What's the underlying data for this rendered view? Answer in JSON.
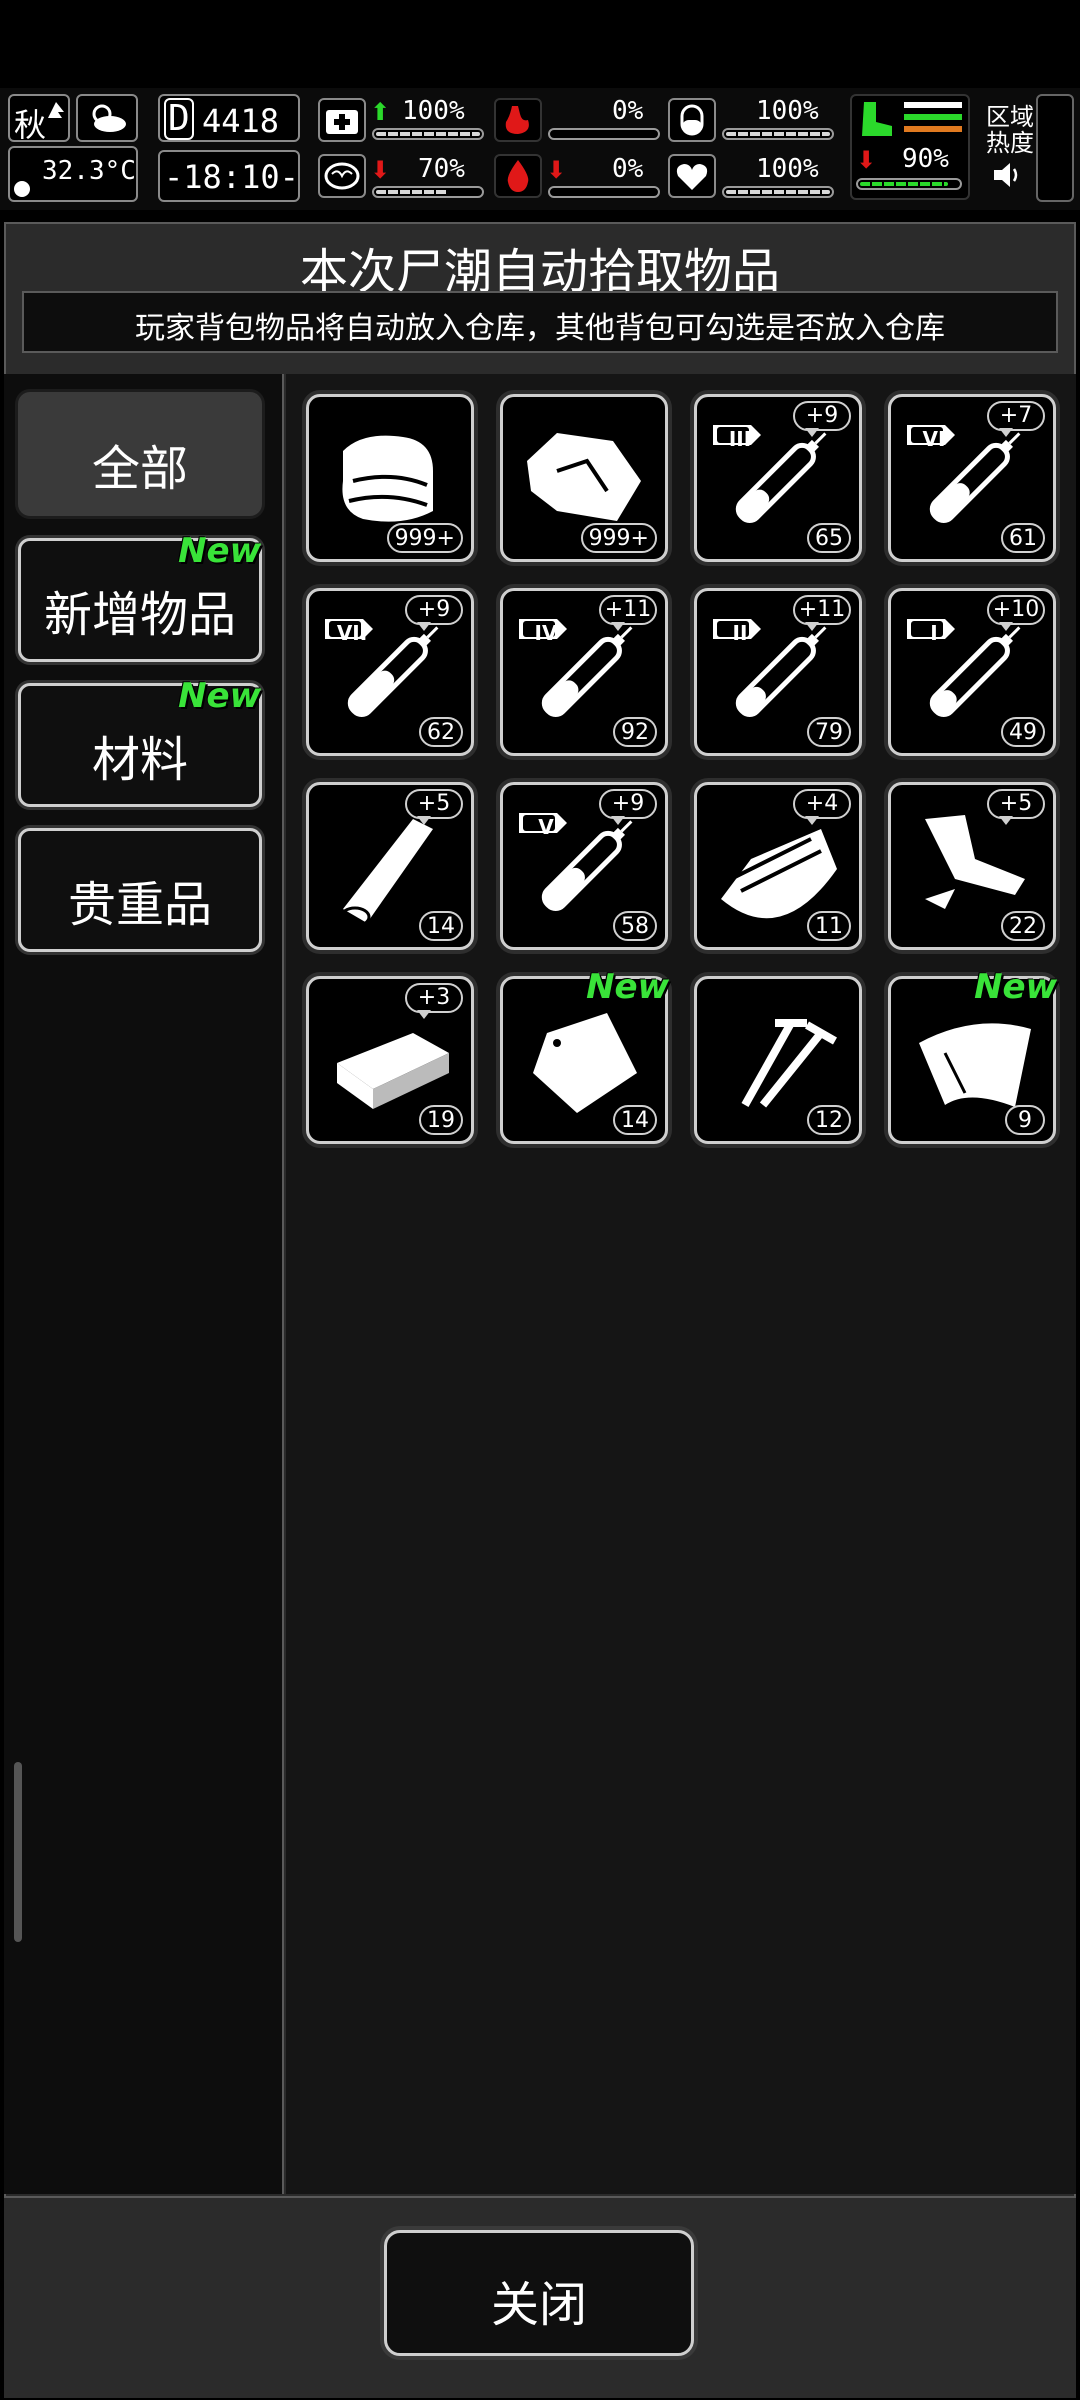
{
  "hud": {
    "season": "秋",
    "temperature": "32.3°C",
    "day": "4418",
    "day_prefix": "D",
    "time": "-18:10-",
    "stats": {
      "health": {
        "value": "100%",
        "fill": 1.0
      },
      "sanity": {
        "value": "70%",
        "fill": 0.7
      },
      "hunger": {
        "value": "0%",
        "fill": 0.0
      },
      "bleeding": {
        "value": "0%",
        "fill": 0.0
      },
      "thirst": {
        "value": "100%",
        "fill": 1.0
      },
      "heart": {
        "value": "100%",
        "fill": 1.0
      },
      "stamina": {
        "value": "90%",
        "fill": 0.9
      }
    },
    "zone_heat_label_line1": "区域",
    "zone_heat_label_line2": "热度"
  },
  "panel": {
    "title": "本次尸潮自动拾取物品",
    "subtitle": "玩家背包物品将自动放入仓库，其他背包可勾选是否放入仓库"
  },
  "categories": [
    {
      "label": "全部",
      "active": true,
      "new": false
    },
    {
      "label": "新增物品",
      "active": false,
      "new": true
    },
    {
      "label": "材料",
      "active": false,
      "new": true
    },
    {
      "label": "贵重品",
      "active": false,
      "new": false
    }
  ],
  "new_tag": "New",
  "items": [
    {
      "icon": "cloth-icon",
      "qty": "999+",
      "plus": ""
    },
    {
      "icon": "ore-icon",
      "qty": "999+",
      "plus": ""
    },
    {
      "icon": "syringe-iii-icon",
      "roman": "III",
      "qty": "65",
      "plus": "+9",
      "level": 0.35
    },
    {
      "icon": "syringe-vi-icon",
      "roman": "VI",
      "qty": "61",
      "plus": "+7",
      "level": 0.45
    },
    {
      "icon": "syringe-vii-icon",
      "roman": "VII",
      "qty": "62",
      "plus": "+9",
      "level": 0.55
    },
    {
      "icon": "syringe-iv-icon",
      "roman": "IV",
      "qty": "92",
      "plus": "+11",
      "level": 0.4
    },
    {
      "icon": "syringe-ii-icon",
      "roman": "II",
      "qty": "79",
      "plus": "+11",
      "level": 0.3
    },
    {
      "icon": "syringe-i-icon",
      "roman": "I",
      "qty": "49",
      "plus": "+10",
      "level": 0.25
    },
    {
      "icon": "wood-plank-icon",
      "qty": "14",
      "plus": "+5"
    },
    {
      "icon": "syringe-v-icon",
      "roman": "V",
      "qty": "58",
      "plus": "+9",
      "level": 0.5
    },
    {
      "icon": "metal-scrap-icon",
      "qty": "11",
      "plus": "+4"
    },
    {
      "icon": "pipe-scrap-icon",
      "qty": "22",
      "plus": "+5"
    },
    {
      "icon": "board-icon",
      "qty": "19",
      "plus": "+3"
    },
    {
      "icon": "bag-icon",
      "qty": "14",
      "plus": "",
      "new": true
    },
    {
      "icon": "nails-icon",
      "qty": "12",
      "plus": ""
    },
    {
      "icon": "sheet-icon",
      "qty": "9",
      "plus": "",
      "new": true
    }
  ],
  "footer": {
    "close_label": "关闭"
  },
  "colors": {
    "accent_green": "#39e339",
    "bleed_red": "#e01818",
    "panel_bg": "#2b2b2b"
  }
}
